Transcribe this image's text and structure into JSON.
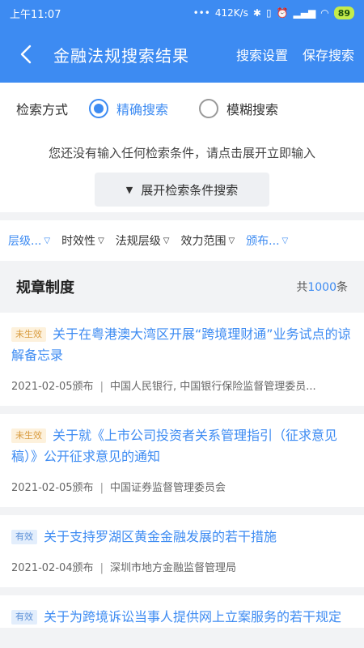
{
  "status": {
    "time": "上午11:07",
    "speed": "412K/s",
    "battery": "89",
    "network": "4G"
  },
  "nav": {
    "title": "金融法规搜索结果",
    "search_settings": "搜索设置",
    "save_search": "保存搜索"
  },
  "mode": {
    "label": "检索方式",
    "exact": "精确搜索",
    "fuzzy": "模糊搜索",
    "selected": "exact"
  },
  "hint": {
    "text": "您还没有输入任何检索条件，请点击展开立即输入",
    "expand_label": "展开检索条件搜索"
  },
  "filters": [
    "层级...",
    "时效性",
    "法规层级",
    "效力范围",
    "颁布..."
  ],
  "section": {
    "title": "规章制度",
    "count_prefix": "共",
    "count": "1000",
    "count_suffix": "条"
  },
  "results": [
    {
      "badge": "未生效",
      "title": "关于在粤港澳大湾区开展“跨境理财通”业务试点的谅解备忘录",
      "date": "2021-02-05颁布",
      "issuer": "中国人民银行, 中国银行保险监督管理委员..."
    },
    {
      "badge": "未生效",
      "title": "关于就《上市公司投资者关系管理指引（征求意见稿）》公开征求意见的通知",
      "date": "2021-02-05颁布",
      "issuer": "中国证券监督管理委员会"
    },
    {
      "badge": "有效",
      "title": "关于支持罗湖区黄金金融发展的若干措施",
      "date": "2021-02-04颁布",
      "issuer": "深圳市地方金融监督管理局"
    },
    {
      "badge": "有效",
      "title": "关于为跨境诉讼当事人提供网上立案服务的若干规定",
      "date": "",
      "issuer": ""
    }
  ],
  "colors": {
    "accent": "#3d8bf2",
    "pending_badge": "#d89a3d",
    "valid_badge": "#5b8fd6"
  }
}
